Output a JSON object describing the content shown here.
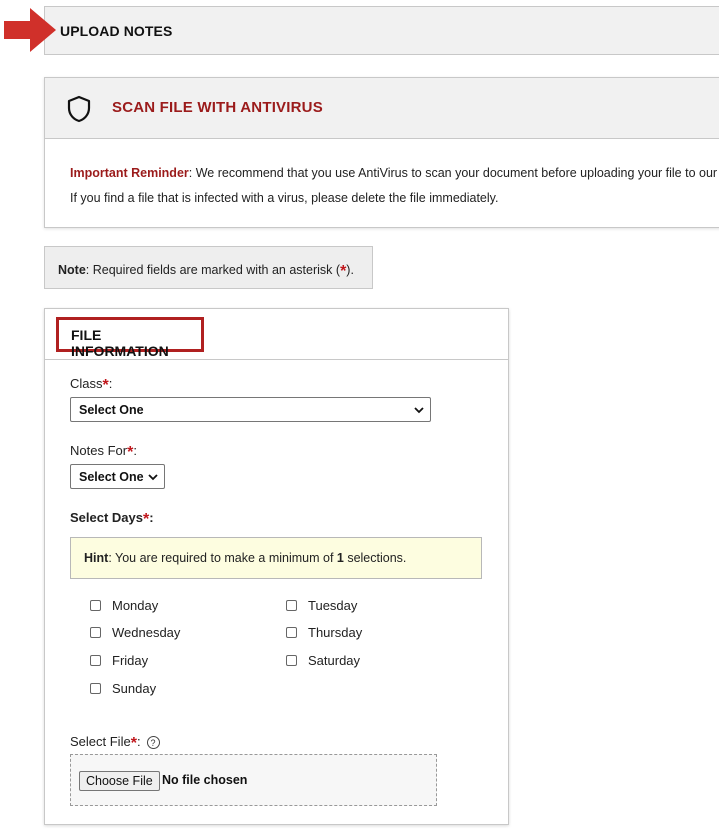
{
  "upload_notes": {
    "title": "UPLOAD NOTES"
  },
  "scan": {
    "title": "SCAN FILE WITH ANTIVIRUS",
    "reminder_label": "Important Reminder",
    "reminder_text": ": We recommend that you use AntiVirus to scan your document before uploading your file to our",
    "infected_text": "If you find a file that is infected with a virus, please delete the file immediately."
  },
  "note": {
    "label": "Note",
    "text_before": ": Required fields are marked with an asterisk (",
    "asterisk": "*",
    "text_after": ")."
  },
  "file_info": {
    "title": "FILE INFORMATION",
    "class_label": "Class",
    "class_value": "Select One",
    "notes_for_label": "Notes For",
    "notes_for_value": "Select One",
    "select_days_label": "Select Days",
    "hint_label": "Hint",
    "hint_text_before": ": You are required to make a minimum of ",
    "hint_count": "1",
    "hint_text_after": " selections.",
    "days": {
      "monday": "Monday",
      "tuesday": "Tuesday",
      "wednesday": "Wednesday",
      "thursday": "Thursday",
      "friday": "Friday",
      "saturday": "Saturday",
      "sunday": "Sunday"
    },
    "select_file_label": "Select File",
    "help_glyph": "?",
    "choose_file_button": "Choose File",
    "no_file_text": "No file chosen"
  },
  "colors": {
    "accent_red": "#9b1b1b",
    "asterisk_red": "#c0171c",
    "hint_bg": "#fdfde0"
  },
  "icons": [
    "arrow-right-icon",
    "shield-icon",
    "chevron-down-icon",
    "help-circle-icon"
  ]
}
